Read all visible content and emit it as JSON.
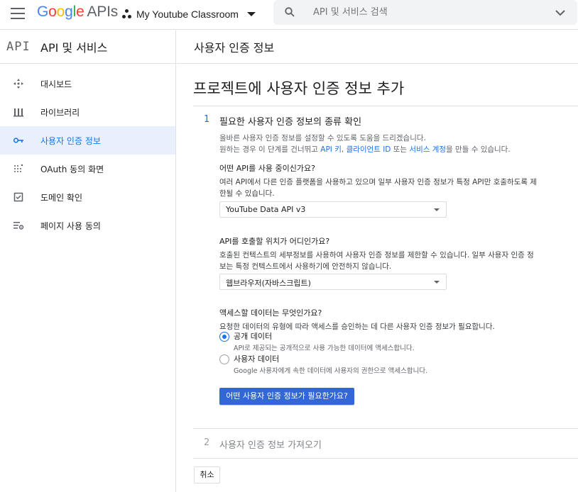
{
  "header": {
    "logo_google": [
      "G",
      "o",
      "o",
      "g",
      "l",
      "e"
    ],
    "logo_apis": "APIs",
    "project_name": "My Youtube Classroom",
    "search_placeholder": "API 및 서비스 검색"
  },
  "sidebar": {
    "badge": "API",
    "title": "API 및 서비스",
    "items": [
      {
        "label": "대시보드",
        "icon": "dashboard-icon",
        "active": false
      },
      {
        "label": "라이브러리",
        "icon": "library-icon",
        "active": false
      },
      {
        "label": "사용자 인증 정보",
        "icon": "key-icon",
        "active": true
      },
      {
        "label": "OAuth 동의 화면",
        "icon": "oauth-consent-icon",
        "active": false
      },
      {
        "label": "도메인 확인",
        "icon": "checkbox-icon",
        "active": false
      },
      {
        "label": "페이지 사용 동의",
        "icon": "settings-list-icon",
        "active": false
      }
    ]
  },
  "breadcrumb": "사용자 인증 정보",
  "main": {
    "title": "프로젝트에 사용자 인증 정보 추가",
    "step1": {
      "num": "1",
      "title": "필요한 사용자 인증 정보의 종류 확인",
      "desc_line1": "올바른 사용자 인증 정보를 설정할 수 있도록 도움을 드리겠습니다.",
      "desc_line2_pre": "원하는 경우 이 단계를 건너뛰고 ",
      "link_api_key": "API 키",
      "comma": ", ",
      "link_client_id": "클라이언트 ID",
      "mid": " 또는 ",
      "link_service_account": "서비스 계정",
      "desc_line2_post": "을 만들 수 있습니다."
    },
    "q1": {
      "label": "어떤 API를 사용 중이신가요?",
      "desc": "여러 API에서 다른 인증 플랫폼을 사용하고 있으며 일부 사용자 인증 정보가 특정 API만 호출하도록 제한될 수 있습니다.",
      "selected": "YouTube Data API v3"
    },
    "q2": {
      "label": "API를 호출할 위치가 어디인가요?",
      "desc": "호출된 컨텍스트의 세부정보를 사용하여 사용자 인증 정보를 제한할 수 있습니다. 일부 사용자 인증 정보는 특정 컨텍스트에서 사용하기에 안전하지 않습니다.",
      "selected": "웹브라우저(자바스크립트)"
    },
    "q3": {
      "label": "액세스할 데이터는 무엇인가요?",
      "desc": "요청한 데이터의 유형에 따라 액세스를 승인하는 데 다른 사용자 인증 정보가 필요합니다.",
      "options": [
        {
          "label": "공개 데이터",
          "sub": "API로 제공되는 공개적으로 사용 가능한 데이터에 액세스합니다.",
          "checked": true
        },
        {
          "label": "사용자 데이터",
          "sub": "Google 사용자에게 속한 데이터에 사용자의 권한으로 액세스합니다.",
          "checked": false
        }
      ]
    },
    "primary_button": "어떤 사용자 인증 정보가 필요한가요?",
    "step2": {
      "num": "2",
      "title": "사용자 인증 정보 가져오기"
    },
    "cancel_button": "취소"
  },
  "colors": {
    "accent": "#1a73e8",
    "primary_button": "#3367d6",
    "active_bg": "#e8f0fe"
  }
}
